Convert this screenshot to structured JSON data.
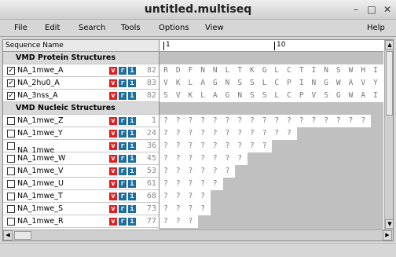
{
  "window": {
    "title": "untitled.multiseq"
  },
  "menu": {
    "items": [
      "File",
      "Edit",
      "Search",
      "Tools",
      "Options",
      "View"
    ],
    "help": "Help"
  },
  "header": {
    "name_label": "Sequence Name",
    "ruler_1": "1",
    "ruler_10": "10"
  },
  "groups": {
    "protein": "VMD Protein Structures",
    "nucleic": "VMD Nucleic Structures"
  },
  "tags": {
    "v": "v",
    "r": "r",
    "i": "i"
  },
  "proteins": [
    {
      "name": "NA_1mwe_A",
      "checked": true,
      "num": "82",
      "seq": [
        "R",
        "D",
        "F",
        "N",
        "N",
        "L",
        "T",
        "K",
        "G",
        "L",
        "C",
        "T",
        "I",
        "N",
        "S",
        "W",
        "H",
        "I"
      ]
    },
    {
      "name": "NA_2hu0_A",
      "checked": true,
      "num": "83",
      "seq": [
        "V",
        "K",
        "L",
        "A",
        "G",
        "N",
        "S",
        "S",
        "L",
        "C",
        "P",
        "I",
        "N",
        "G",
        "W",
        "A",
        "V",
        "Y"
      ]
    },
    {
      "name": "NA_3nss_A",
      "checked": true,
      "num": "82",
      "seq": [
        "S",
        "V",
        "K",
        "L",
        "A",
        "G",
        "N",
        "S",
        "S",
        "L",
        "C",
        "P",
        "V",
        "S",
        "G",
        "W",
        "A",
        "I"
      ]
    }
  ],
  "nucleic": [
    {
      "name": "NA_1mwe_Z",
      "checked": false,
      "num": "1",
      "seq": "?????????????????"
    },
    {
      "name": "NA_1mwe_Y",
      "checked": false,
      "num": "24",
      "seq": "???????????"
    },
    {
      "name": "NA_1mwe_",
      "checked": false,
      "num": "36",
      "seq": "?????????"
    },
    {
      "name": "NA_1mwe_W",
      "checked": false,
      "num": "45",
      "seq": "???????"
    },
    {
      "name": "NA_1mwe_V",
      "checked": false,
      "num": "53",
      "seq": "??????"
    },
    {
      "name": "NA_1mwe_U",
      "checked": false,
      "num": "61",
      "seq": "?????"
    },
    {
      "name": "NA_1mwe_T",
      "checked": false,
      "num": "68",
      "seq": "????"
    },
    {
      "name": "NA_1mwe_S",
      "checked": false,
      "num": "73",
      "seq": "????"
    },
    {
      "name": "NA_1mwe_R",
      "checked": false,
      "num": "77",
      "seq": "???"
    }
  ],
  "colors": {
    "tag_v": "#e02020",
    "tag_ri": "#1b6e9e",
    "seq_bg": "#c0c0c0",
    "group_bg": "#d8d8d8"
  }
}
